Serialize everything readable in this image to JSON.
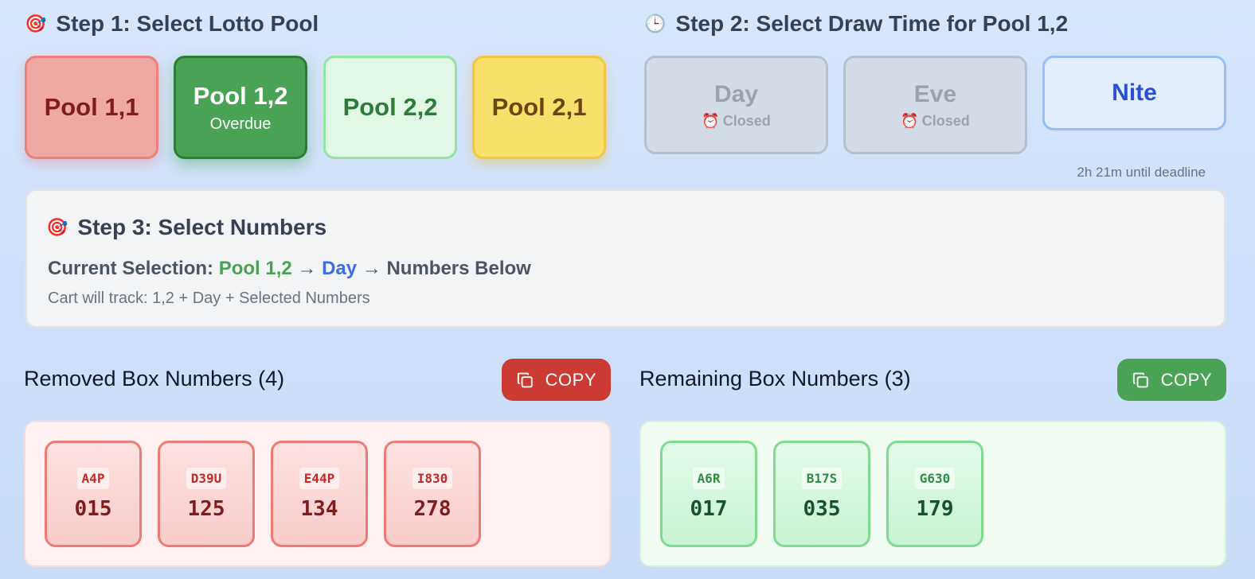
{
  "step1": {
    "icon": "target-icon",
    "title": "Step 1: Select Lotto Pool",
    "pools": [
      {
        "name": "Pool 1,1",
        "sub": ""
      },
      {
        "name": "Pool 1,2",
        "sub": "Overdue"
      },
      {
        "name": "Pool 2,2",
        "sub": ""
      },
      {
        "name": "Pool 2,1",
        "sub": ""
      }
    ]
  },
  "step2": {
    "icon": "clock-icon",
    "title": "Step 2: Select Draw Time for Pool 1,2",
    "times": [
      {
        "name": "Day",
        "status": "Closed"
      },
      {
        "name": "Eve",
        "status": "Closed"
      },
      {
        "name": "Nite",
        "status": ""
      }
    ],
    "deadline": "2h 21m until deadline"
  },
  "step3": {
    "icon": "target-icon",
    "title": "Step 3: Select Numbers",
    "current_label": "Current Selection:",
    "current_pool": "Pool 1,2",
    "current_time": "Day",
    "current_rest": "Numbers Below",
    "cart_track": "Cart will track: 1,2 + Day + Selected Numbers"
  },
  "removed": {
    "title": "Removed Box Numbers (4)",
    "copy_label": "COPY",
    "items": [
      {
        "code": "A4P",
        "num": "015"
      },
      {
        "code": "D39U",
        "num": "125"
      },
      {
        "code": "E44P",
        "num": "134"
      },
      {
        "code": "I830",
        "num": "278"
      }
    ]
  },
  "remaining": {
    "title": "Remaining Box Numbers (3)",
    "copy_label": "COPY",
    "items": [
      {
        "code": "A6R",
        "num": "017"
      },
      {
        "code": "B17S",
        "num": "035"
      },
      {
        "code": "G630",
        "num": "179"
      }
    ]
  },
  "colors": {
    "accent_green": "#4aa354",
    "accent_red": "#cb3a33",
    "accent_blue": "#2a4ed4",
    "pool_yellow": "#f9e06a"
  }
}
